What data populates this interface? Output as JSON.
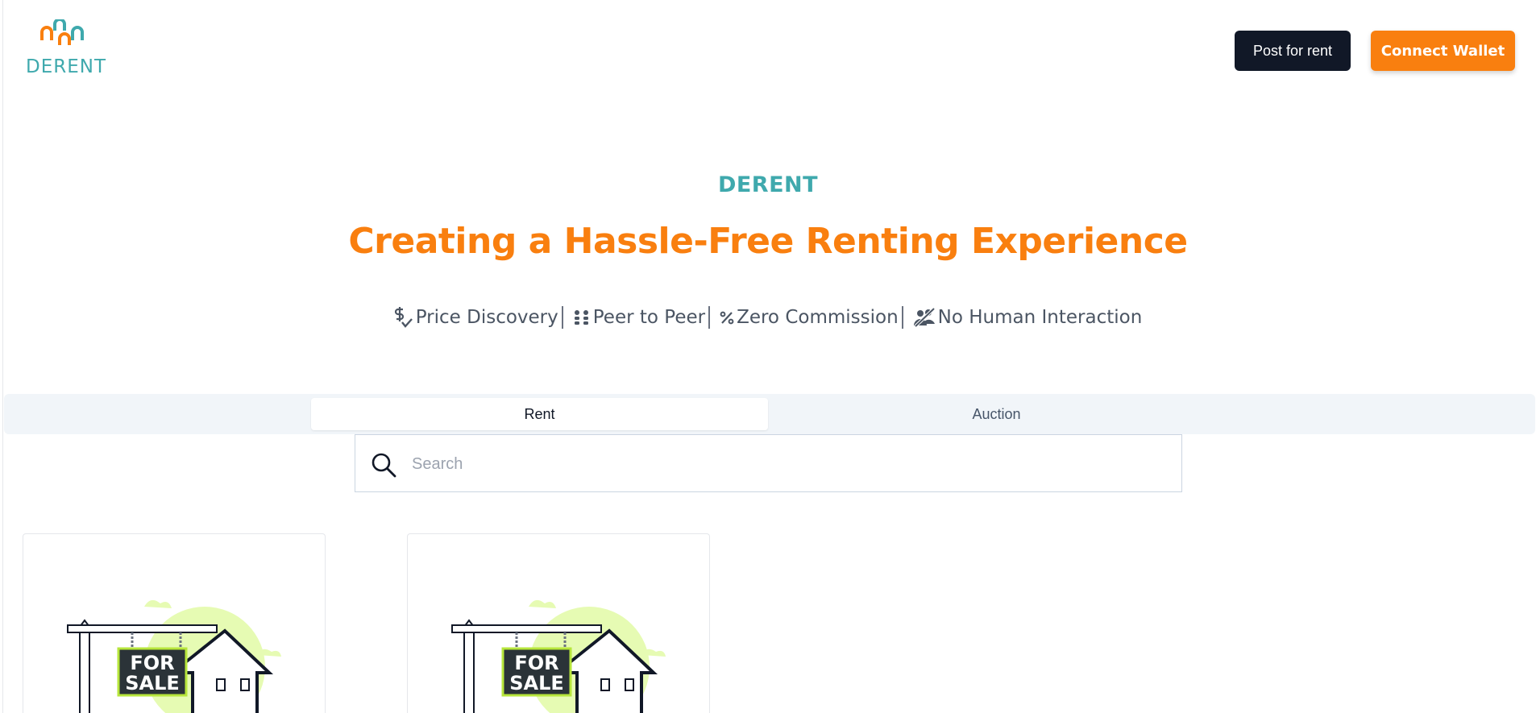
{
  "header": {
    "logo_text": "DERENT",
    "post_button": "Post for rent",
    "wallet_button": "Connect Wallet"
  },
  "hero": {
    "eyebrow": "DERENT",
    "headline": "Creating a Hassle-Free Renting Experience",
    "features": [
      {
        "icon": "dollar-check-icon",
        "label": "Price Discovery"
      },
      {
        "icon": "peer-icon",
        "label": "Peer to Peer"
      },
      {
        "icon": "percent-icon",
        "label": "Zero Commission"
      },
      {
        "icon": "no-people-icon",
        "label": "No Human Interaction"
      }
    ]
  },
  "tabs": [
    {
      "label": "Rent",
      "active": true
    },
    {
      "label": "Auction",
      "active": false
    }
  ],
  "search": {
    "placeholder": "Search",
    "value": ""
  },
  "listings": [
    {
      "image": "for-sale-house-illustration",
      "sign_line1": "FOR",
      "sign_line2": "SALE"
    },
    {
      "image": "for-sale-house-illustration",
      "sign_line1": "FOR",
      "sign_line2": "SALE"
    }
  ],
  "colors": {
    "brand_teal": "#3fa9ad",
    "brand_orange": "#f97f0f",
    "dark_button": "#111827",
    "tabs_background": "#f1f5f9"
  }
}
